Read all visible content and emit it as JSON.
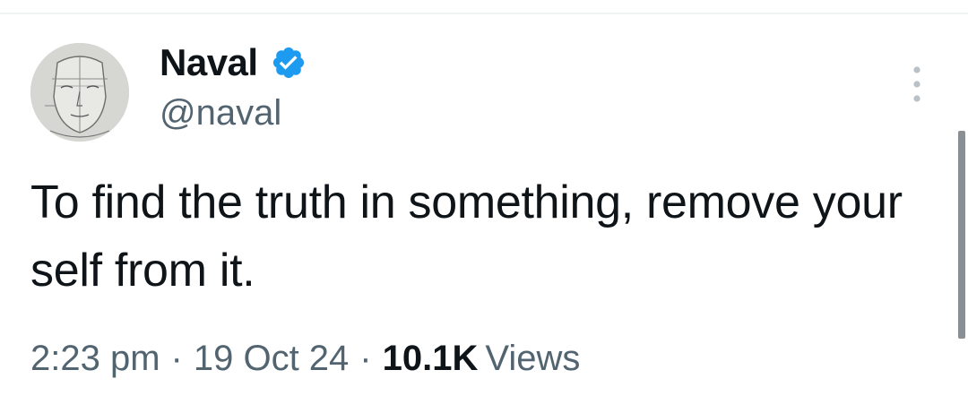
{
  "tweet": {
    "author": {
      "display_name": "Naval",
      "handle": "@naval",
      "verified": true,
      "avatar": "avatar-sketch"
    },
    "text": "To find the truth in something, remove your self from it.",
    "time": "2:23 pm",
    "date": "19 Oct 24",
    "separator": "·",
    "views_count": "10.1K",
    "views_label": "Views"
  },
  "icons": {
    "verified": "verified-badge-icon",
    "more": "more-options-icon"
  },
  "colors": {
    "text_primary": "#0f1419",
    "text_secondary": "#536471",
    "verified_blue": "#1d9bf0",
    "divider": "#eff3f4"
  }
}
